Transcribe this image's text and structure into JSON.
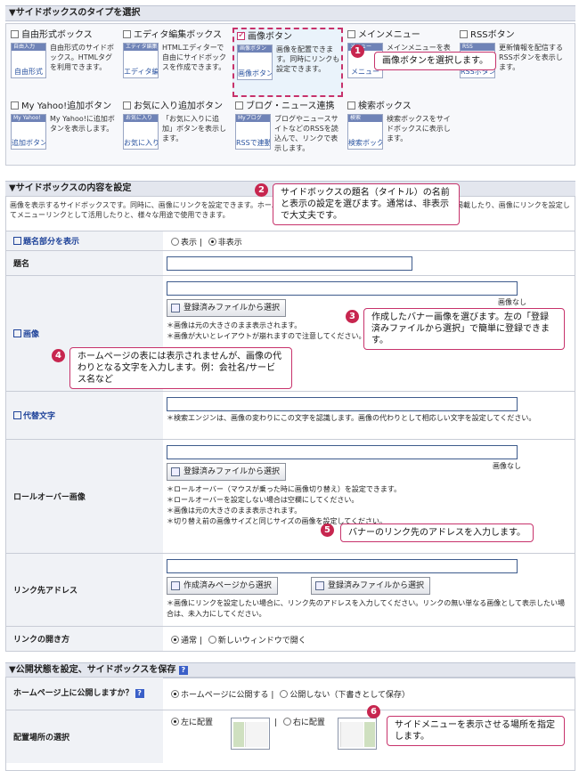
{
  "type_section": {
    "title": "▼サイドボックスのタイプを選択",
    "items": [
      {
        "label": "自由形式ボックス",
        "thumb_title": "自由入力",
        "thumb_text": "自由形式",
        "desc": "自由形式のサイドボックス。HTMLタグを利用できます。",
        "checked": false
      },
      {
        "label": "エディタ編集ボックス",
        "thumb_title": "エディタ編集",
        "thumb_text": "エディタ編集",
        "desc": "HTMLエディターで自由にサイドボックスを作成できます。",
        "checked": false
      },
      {
        "label": "画像ボタン",
        "thumb_title": "画像ボタン",
        "thumb_text": "画像ボタン",
        "desc": "画像を配置できます。同時にリンクも設定できます。",
        "checked": true
      },
      {
        "label": "メインメニュー",
        "thumb_title": "メニュー",
        "thumb_text": "メニュー",
        "desc": "メインメニューを表示します。",
        "checked": false
      },
      {
        "label": "RSSボタン",
        "thumb_title": "RSS",
        "thumb_text": "RSSボタン",
        "desc": "更新情報を配信するRSSボタンを表示します。",
        "checked": false
      },
      {
        "label": "My Yahoo!追加ボタン",
        "thumb_title": "My Yahoo!",
        "thumb_text": "追加ボタン",
        "desc": "My Yahoo!に追加ボタンを表示します。",
        "checked": false
      },
      {
        "label": "お気に入り追加ボタン",
        "thumb_title": "お気に入り",
        "thumb_text": "お気に入り",
        "desc": "「お気に入りに追加」ボタンを表示します。",
        "checked": false
      },
      {
        "label": "ブログ・ニュース連携",
        "thumb_title": "Myブログ",
        "thumb_text": "RSSで連動",
        "desc": "ブログやニュースサイトなどのRSSを読込んで、リンクで表示します。",
        "checked": false
      },
      {
        "label": "検索ボックス",
        "thumb_title": "検索",
        "thumb_text": "検索ボックス",
        "desc": "検索ボックスをサイドボックスに表示します。",
        "checked": false
      }
    ]
  },
  "content_section": {
    "title": "▼サイドボックスの内容を設定",
    "intro": "画像を表示するサイドボックスです。同時に、画像にリンクを設定できます。ホームページへのリンクや、画像に付けたリンクとして画像を掲載したり、画像にリンクを設定してメニューリンクとして活用したりと、様々な用途で使用できます。",
    "title_display": {
      "label": "題名部分を表示",
      "opt_show": "表示 |",
      "opt_hide": "非表示"
    },
    "name": {
      "label": "題名",
      "value": ""
    },
    "image": {
      "label": "画像",
      "none": "画像なし",
      "btn": "登録済みファイルから選択",
      "notes": [
        "＊画像は元の大きさのまま表示されます。",
        "＊画像が大いとレイアウトが崩れますので注意してください。"
      ]
    },
    "alt": {
      "label": "代替文字",
      "note": "＊検索エンジンは、画像の変わりにこの文字を認識します。画像の代わりとして相応しい文字を設定してください。"
    },
    "rollover": {
      "label": "ロールオーバー画像",
      "none": "画像なし",
      "btn": "登録済みファイルから選択",
      "notes": [
        "＊ロールオーバー（マウスが乗った時に画像切り替え）を設定できます。",
        "＊ロールオーバーを設定しない場合は空欄にしてください。",
        "＊画像は元の大きさのまま表示されます。",
        "＊切り替え前の画像サイズと同じサイズの画像を設定してください。"
      ]
    },
    "link": {
      "label": "リンク先アドレス",
      "btn_page": "作成済みページから選択",
      "btn_file": "登録済みファイルから選択",
      "note": "＊画像にリンクを設定したい場合に、リンク先のアドレスを入力してください。リンクの無い単なる画像として表示したい場合は、未入力にしてください。"
    },
    "open": {
      "label": "リンクの開き方",
      "opt_normal": "通常 |",
      "opt_new": "新しいウィンドウで開く"
    }
  },
  "publish_section": {
    "title": "▼公開状態を設定、サイドボックスを保存",
    "help": "?",
    "publish": {
      "label": "ホームページ上に公開しますか？",
      "opt_pub": "ホームページに公開する |",
      "opt_draft": "公開しない（下書きとして保存）"
    },
    "placement": {
      "label": "配置場所の選択",
      "opt_left": "左に配置",
      "opt_right": "右に配置",
      "sep": "|"
    }
  },
  "callouts": {
    "c1": {
      "num": "1",
      "text": "画像ボタンを選択します。"
    },
    "c2": {
      "num": "2",
      "text": "サイドボックスの題名（タイトル）の名前と表示の設定を選びます。通常は、非表示で大丈夫です。"
    },
    "c3": {
      "num": "3",
      "text": "作成したバナー画像を選びます。左の「登録済みファイルから選択」で簡単に登録できます。"
    },
    "c4": {
      "num": "4",
      "text": "ホームページの表には表示されませんが、画像の代わりとなる文字を入力します。例：会社名/サービス名など"
    },
    "c5": {
      "num": "5",
      "text": "バナーのリンク先のアドレスを入力します。"
    },
    "c6": {
      "num": "6",
      "text": "サイドメニューを表示させる場所を指定します。"
    }
  }
}
